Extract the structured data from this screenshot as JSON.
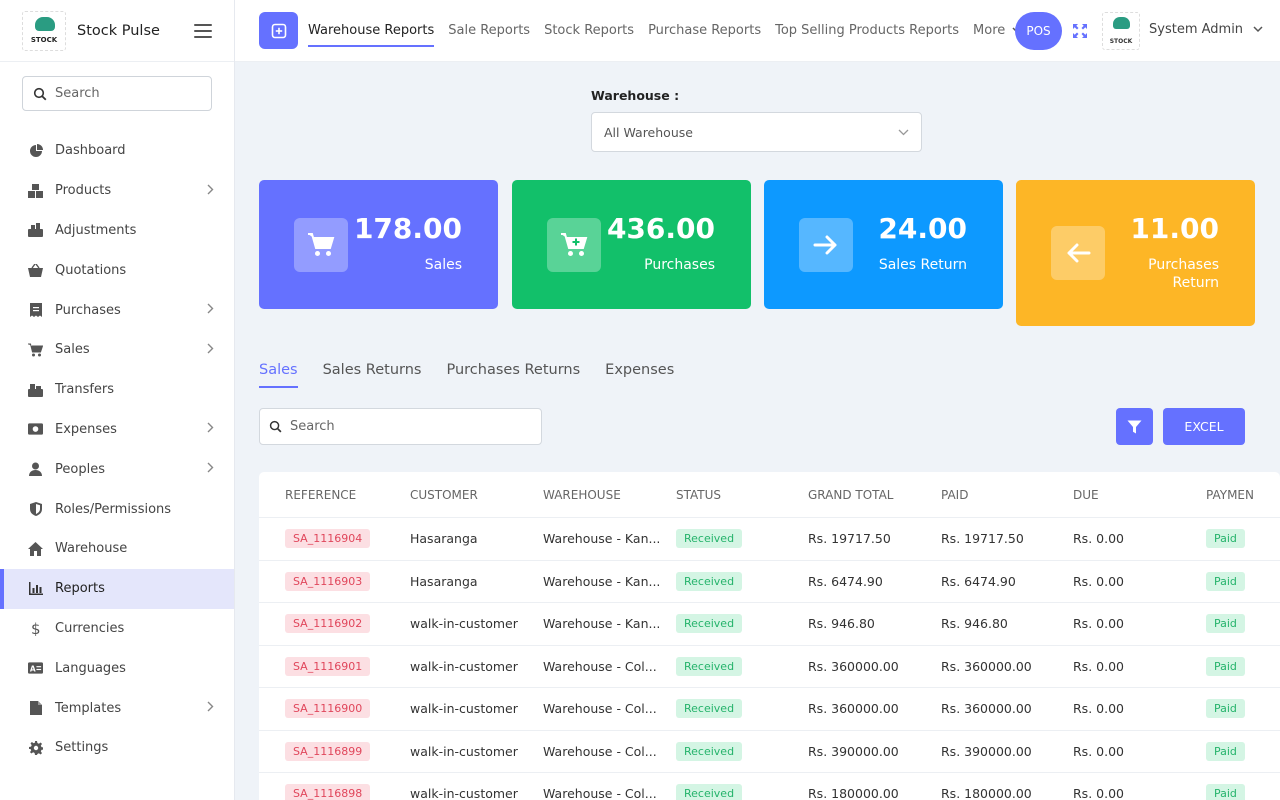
{
  "brand": {
    "name": "Stock Pulse",
    "logo_text": "STOCK"
  },
  "sidebar": {
    "search_placeholder": "Search",
    "items": [
      {
        "label": "Dashboard",
        "icon": "pie-chart-icon",
        "chevron": false
      },
      {
        "label": "Products",
        "icon": "boxes-icon",
        "chevron": true
      },
      {
        "label": "Adjustments",
        "icon": "adjust-icon",
        "chevron": false
      },
      {
        "label": "Quotations",
        "icon": "basket-icon",
        "chevron": false
      },
      {
        "label": "Purchases",
        "icon": "receipt-icon",
        "chevron": true
      },
      {
        "label": "Sales",
        "icon": "cart-icon",
        "chevron": true
      },
      {
        "label": "Transfers",
        "icon": "transfer-icon",
        "chevron": false
      },
      {
        "label": "Expenses",
        "icon": "money-icon",
        "chevron": true
      },
      {
        "label": "Peoples",
        "icon": "user-icon",
        "chevron": true
      },
      {
        "label": "Roles/Permissions",
        "icon": "shield-icon",
        "chevron": false
      },
      {
        "label": "Warehouse",
        "icon": "home-icon",
        "chevron": false
      },
      {
        "label": "Reports",
        "icon": "bar-chart-icon",
        "chevron": false,
        "active": true
      },
      {
        "label": "Currencies",
        "icon": "dollar-icon",
        "chevron": false
      },
      {
        "label": "Languages",
        "icon": "language-icon",
        "chevron": false
      },
      {
        "label": "Templates",
        "icon": "file-icon",
        "chevron": true
      },
      {
        "label": "Settings",
        "icon": "gear-icon",
        "chevron": false
      }
    ]
  },
  "topbar": {
    "tabs": [
      "Warehouse Reports",
      "Sale Reports",
      "Stock Reports",
      "Purchase Reports",
      "Top Selling Products Reports",
      "More"
    ],
    "pos_label": "POS",
    "user_name": "System Admin",
    "user_logo_text": "STOCK"
  },
  "filter": {
    "label": "Warehouse :",
    "selected": "All Warehouse"
  },
  "cards": [
    {
      "value": "178.00",
      "label": "Sales",
      "color": "#6571ff",
      "icon": "cart-icon"
    },
    {
      "value": "436.00",
      "label": "Purchases",
      "color": "#12c06a",
      "icon": "cart-plus-icon"
    },
    {
      "value": "24.00",
      "label": "Sales Return",
      "color": "#0d99ff",
      "icon": "arrow-right-icon"
    },
    {
      "value": "11.00",
      "label": "Purchases Return",
      "color": "#fdb626",
      "icon": "arrow-left-icon"
    }
  ],
  "tabs": [
    "Sales",
    "Sales Returns",
    "Purchases Returns",
    "Expenses"
  ],
  "table": {
    "search_placeholder": "Search",
    "excel_label": "EXCEL",
    "headers": [
      "REFERENCE",
      "CUSTOMER",
      "WAREHOUSE",
      "STATUS",
      "GRAND TOTAL",
      "PAID",
      "DUE",
      "PAYMEN"
    ],
    "rows": [
      {
        "reference": "SA_1116904",
        "customer": "Hasaranga",
        "warehouse": "Warehouse - Kan...",
        "status": "Received",
        "grand_total": "Rs. 19717.50",
        "paid": "Rs. 19717.50",
        "due": "Rs. 0.00",
        "payment": "Paid"
      },
      {
        "reference": "SA_1116903",
        "customer": "Hasaranga",
        "warehouse": "Warehouse - Kan...",
        "status": "Received",
        "grand_total": "Rs. 6474.90",
        "paid": "Rs. 6474.90",
        "due": "Rs. 0.00",
        "payment": "Paid"
      },
      {
        "reference": "SA_1116902",
        "customer": "walk-in-customer",
        "warehouse": "Warehouse - Kan...",
        "status": "Received",
        "grand_total": "Rs. 946.80",
        "paid": "Rs. 946.80",
        "due": "Rs. 0.00",
        "payment": "Paid"
      },
      {
        "reference": "SA_1116901",
        "customer": "walk-in-customer",
        "warehouse": "Warehouse - Col...",
        "status": "Received",
        "grand_total": "Rs. 360000.00",
        "paid": "Rs. 360000.00",
        "due": "Rs. 0.00",
        "payment": "Paid"
      },
      {
        "reference": "SA_1116900",
        "customer": "walk-in-customer",
        "warehouse": "Warehouse - Col...",
        "status": "Received",
        "grand_total": "Rs. 360000.00",
        "paid": "Rs. 360000.00",
        "due": "Rs. 0.00",
        "payment": "Paid"
      },
      {
        "reference": "SA_1116899",
        "customer": "walk-in-customer",
        "warehouse": "Warehouse - Col...",
        "status": "Received",
        "grand_total": "Rs. 390000.00",
        "paid": "Rs. 390000.00",
        "due": "Rs. 0.00",
        "payment": "Paid"
      },
      {
        "reference": "SA_1116898",
        "customer": "walk-in-customer",
        "warehouse": "Warehouse - Col...",
        "status": "Received",
        "grand_total": "Rs. 180000.00",
        "paid": "Rs. 180000.00",
        "due": "Rs. 0.00",
        "payment": "Paid"
      }
    ]
  }
}
